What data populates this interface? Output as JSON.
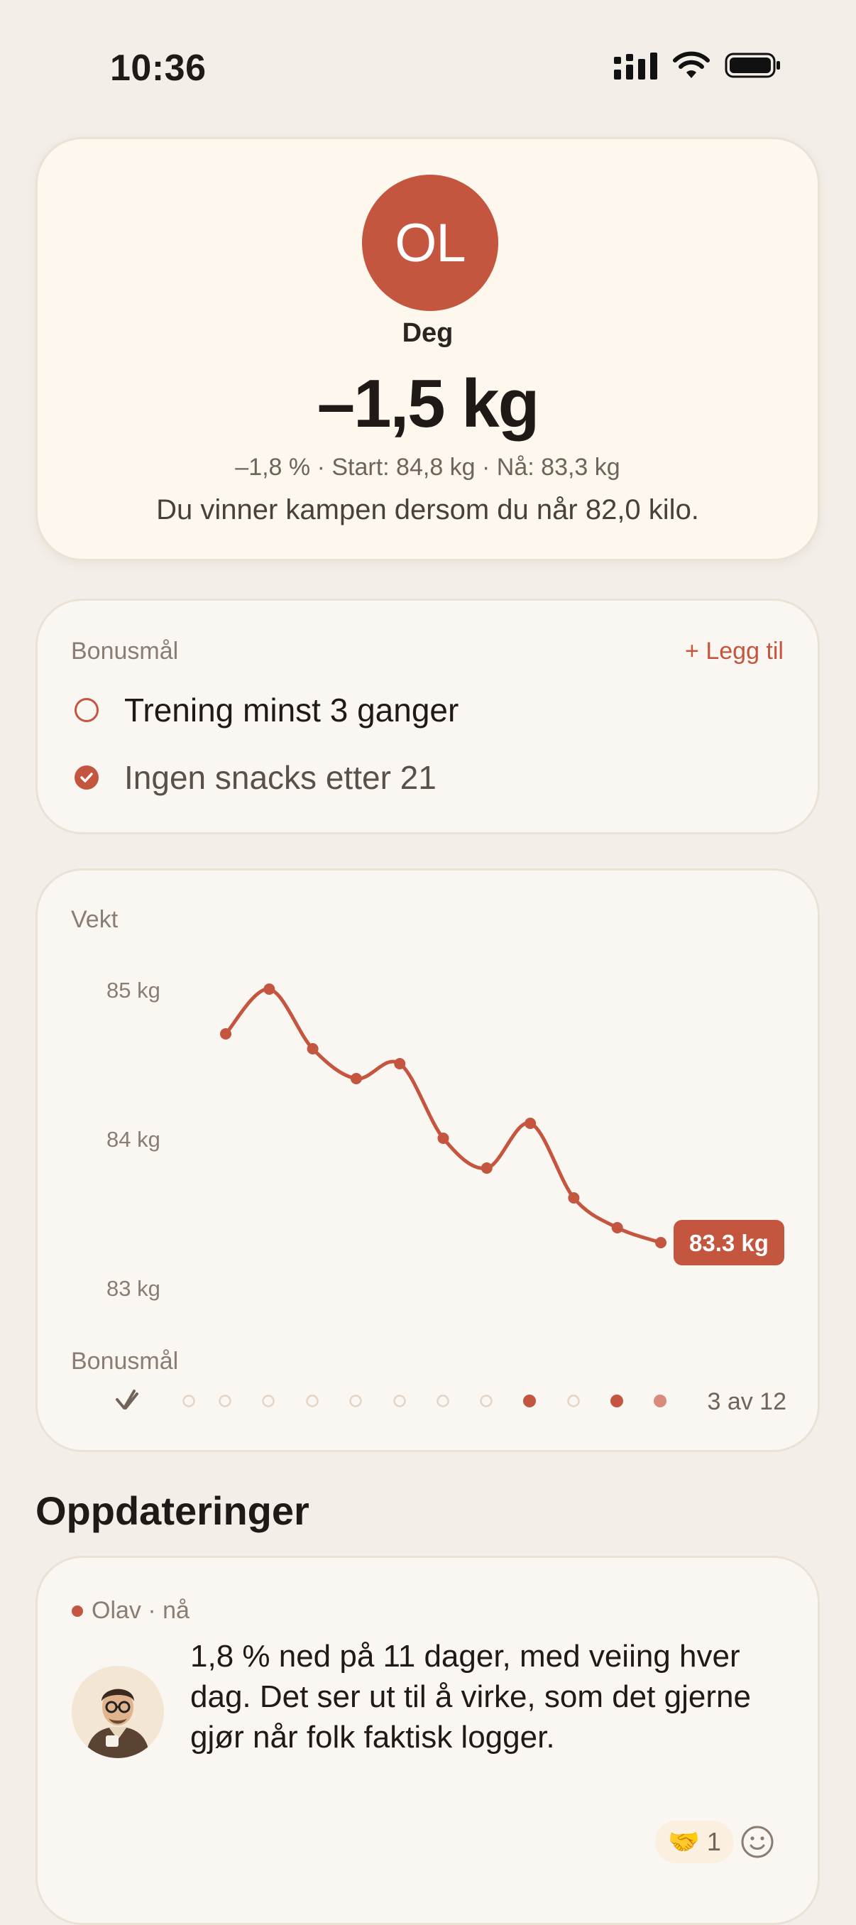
{
  "status_bar": {
    "time": "10:36"
  },
  "hero": {
    "initials": "OL",
    "name": "Deg",
    "delta": "–1,5 kg",
    "stats": "–1,8 % · Start: 84,8 kg · Nå: 83,3 kg",
    "goal_text": "Du vinner kampen dersom du når 82,0 kilo."
  },
  "bonus": {
    "title": "Bonusmål",
    "add_label": "+ Legg til",
    "goals": [
      {
        "label": "Trening minst 3 ganger",
        "done": false
      },
      {
        "label": "Ingen snacks etter 21",
        "done": true
      }
    ]
  },
  "chart_data": {
    "type": "line",
    "title": "Vekt",
    "y_tick_labels": [
      "85 kg",
      "84 kg",
      "83 kg"
    ],
    "ylim": [
      83,
      85
    ],
    "x": [
      1,
      2,
      3,
      4,
      5,
      6,
      7,
      8,
      9,
      10,
      11
    ],
    "values": [
      84.7,
      85.0,
      84.6,
      84.4,
      84.5,
      84.0,
      83.8,
      84.1,
      83.6,
      83.4,
      83.3
    ],
    "current_label": "83.3 kg",
    "line_color": "#c4553f",
    "bonus_row": {
      "title": "Bonusmål",
      "status": [
        0,
        0,
        0,
        0,
        0,
        0,
        0,
        0,
        1,
        0,
        1,
        2
      ],
      "count_label": "3 av 12"
    }
  },
  "updates": {
    "heading": "Oppdateringer",
    "items": [
      {
        "meta": "Olav · nå",
        "text": "1,8 % ned på 11 dager, med veiing hver dag. Det ser ut til å virke, som det gjerne gjør når folk faktisk logger.",
        "reaction_emoji": "🤝",
        "reaction_count": "1"
      }
    ]
  },
  "colors": {
    "accent": "#c4553f",
    "background": "#f3eee8"
  }
}
